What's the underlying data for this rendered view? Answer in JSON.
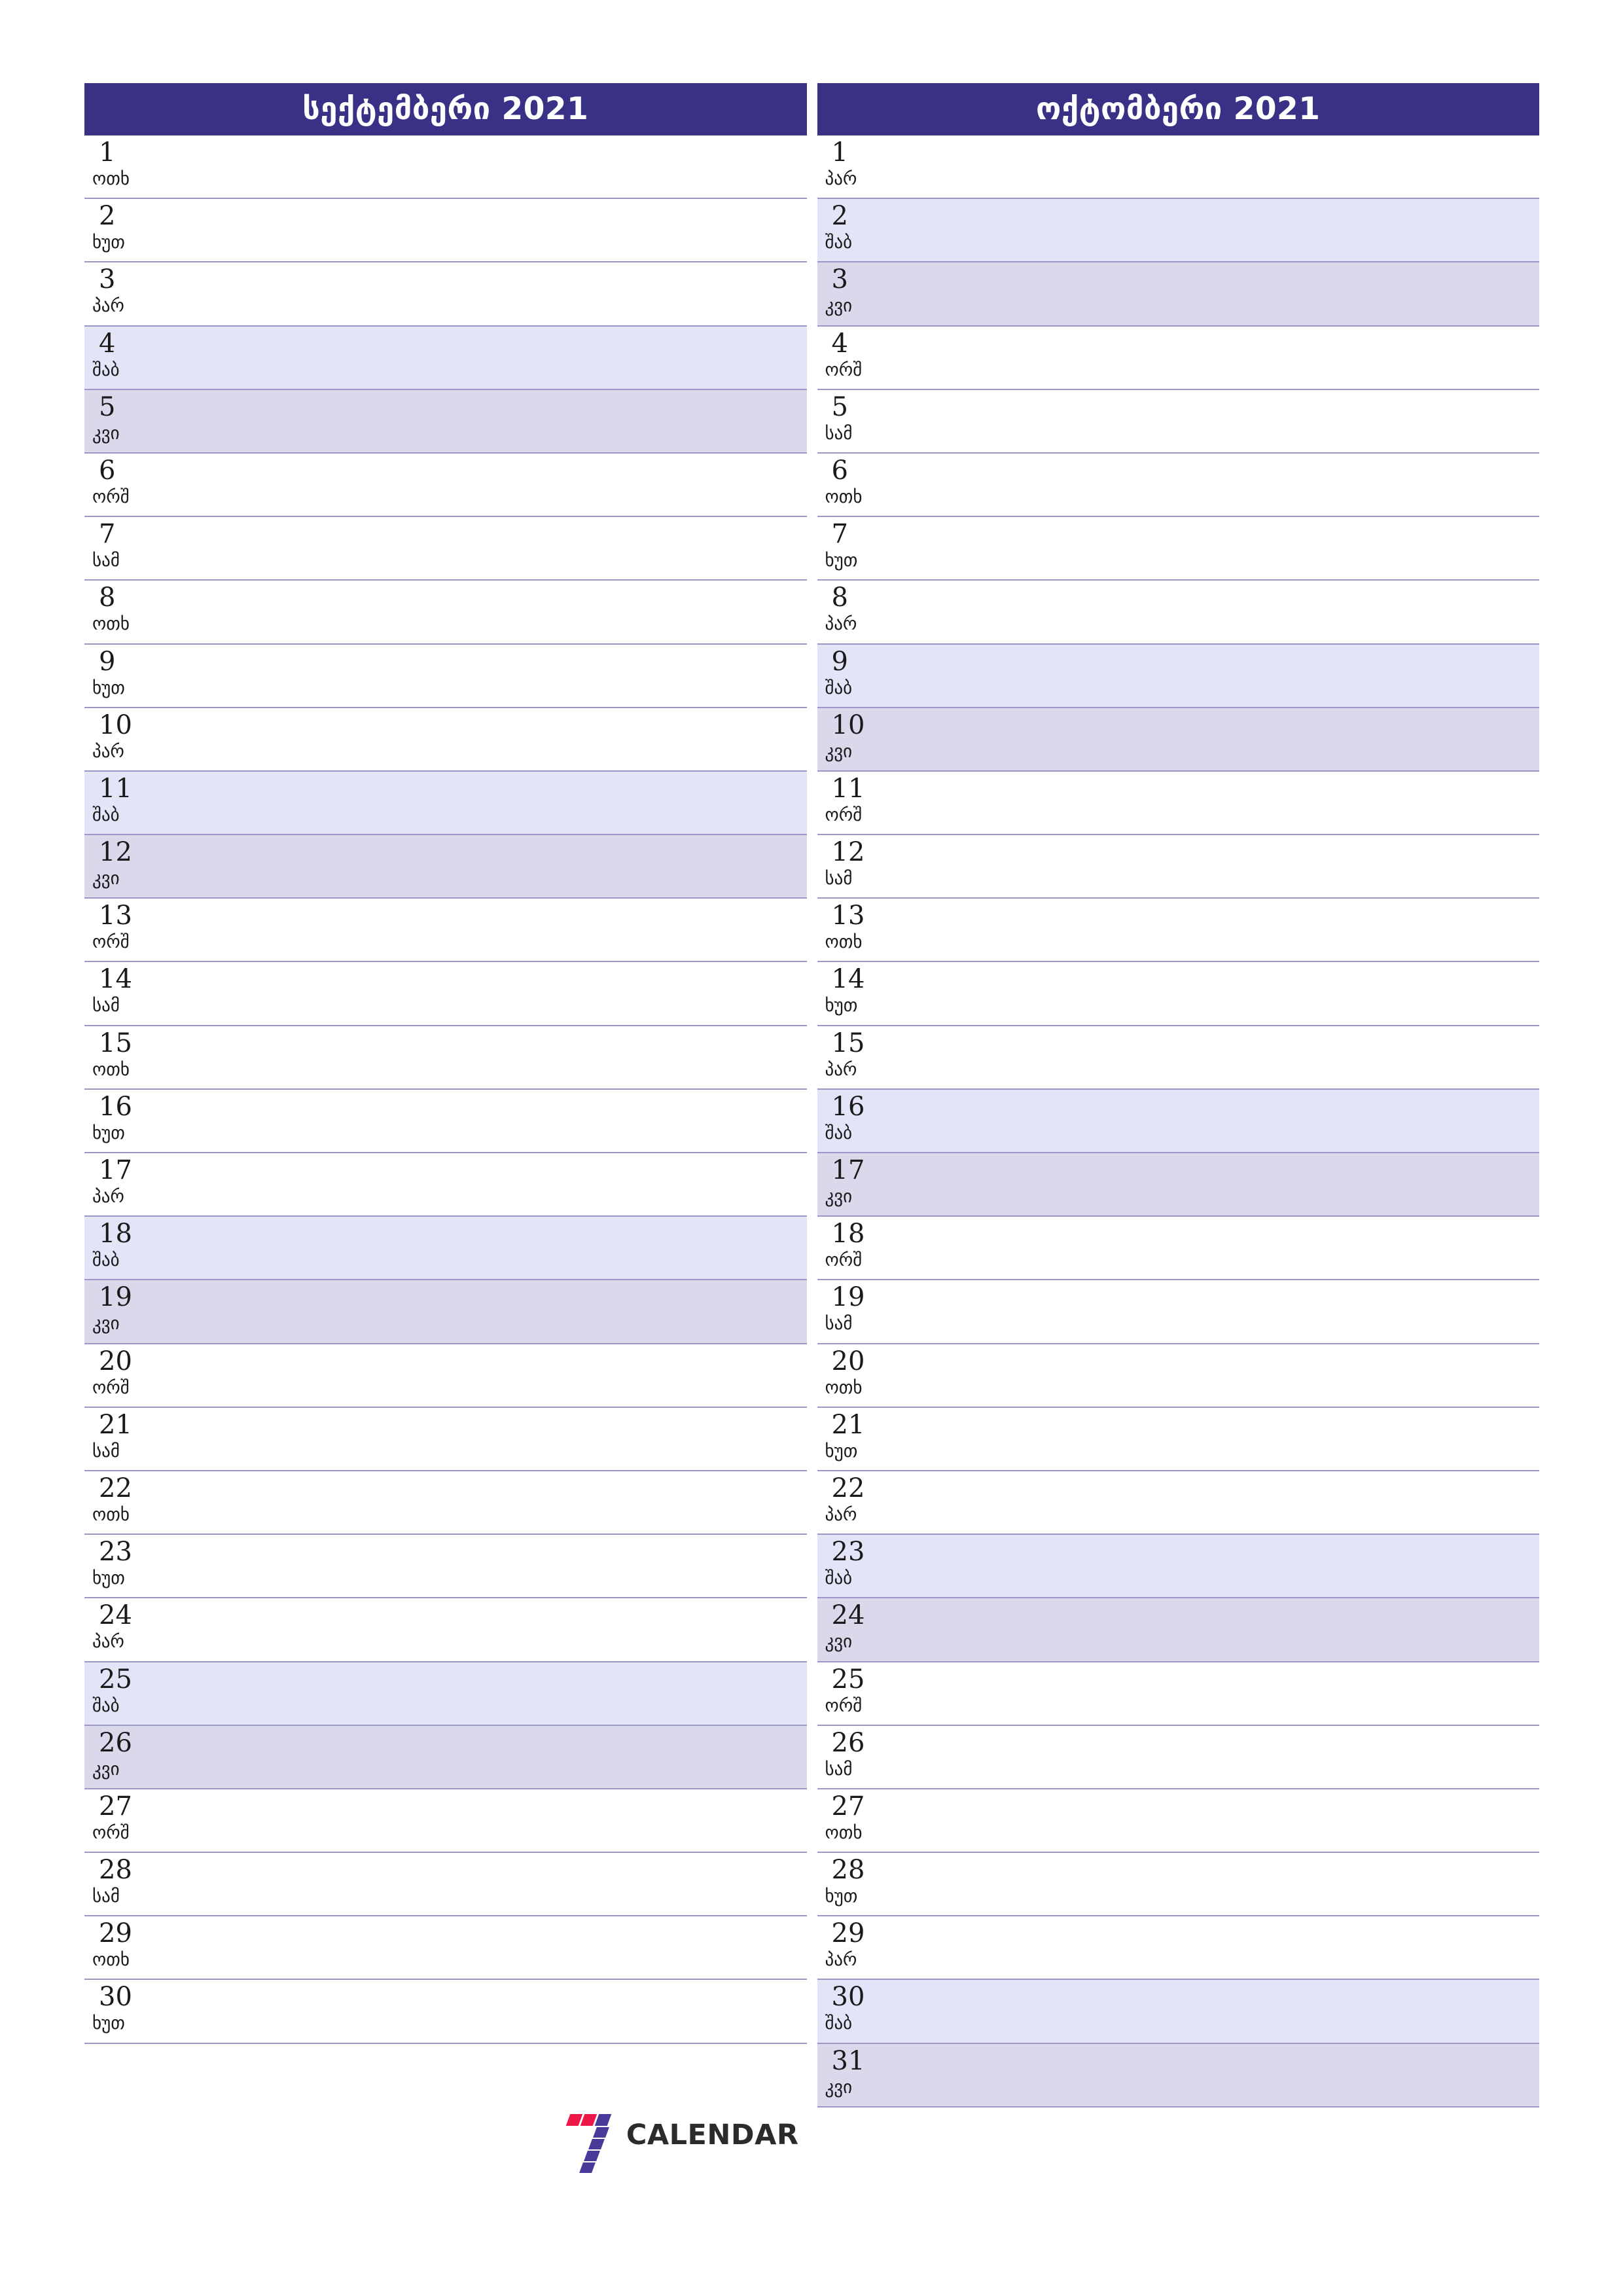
{
  "page": {
    "title": "Monthly planner September October 2021",
    "locale": "ka",
    "colors": {
      "header_bg": "#393185",
      "header_text": "#ffffff",
      "row_border": "#9b98c8",
      "saturday_bg": "#e3e4f7",
      "sunday_bg": "#dcd8ec",
      "day_text": "#1a1a1a",
      "logo_red": "#ed1847",
      "logo_purple": "#473a98",
      "logo_text": "#2b2b2e"
    }
  },
  "logo": {
    "mark": "seven-stripes-icon",
    "text": "CALENDAR"
  },
  "months": [
    {
      "title": "სექტემბერი 2021",
      "name": "სექტემბერი",
      "year": "2021",
      "days": [
        {
          "num": "1",
          "abbr": "ოთხ",
          "type": "weekday"
        },
        {
          "num": "2",
          "abbr": "ხუთ",
          "type": "weekday"
        },
        {
          "num": "3",
          "abbr": "პარ",
          "type": "weekday"
        },
        {
          "num": "4",
          "abbr": "შაბ",
          "type": "sat"
        },
        {
          "num": "5",
          "abbr": "კვი",
          "type": "sun"
        },
        {
          "num": "6",
          "abbr": "ორშ",
          "type": "weekday"
        },
        {
          "num": "7",
          "abbr": "სამ",
          "type": "weekday"
        },
        {
          "num": "8",
          "abbr": "ოთხ",
          "type": "weekday"
        },
        {
          "num": "9",
          "abbr": "ხუთ",
          "type": "weekday"
        },
        {
          "num": "10",
          "abbr": "პარ",
          "type": "weekday"
        },
        {
          "num": "11",
          "abbr": "შაბ",
          "type": "sat"
        },
        {
          "num": "12",
          "abbr": "კვი",
          "type": "sun"
        },
        {
          "num": "13",
          "abbr": "ორშ",
          "type": "weekday"
        },
        {
          "num": "14",
          "abbr": "სამ",
          "type": "weekday"
        },
        {
          "num": "15",
          "abbr": "ოთხ",
          "type": "weekday"
        },
        {
          "num": "16",
          "abbr": "ხუთ",
          "type": "weekday"
        },
        {
          "num": "17",
          "abbr": "პარ",
          "type": "weekday"
        },
        {
          "num": "18",
          "abbr": "შაბ",
          "type": "sat"
        },
        {
          "num": "19",
          "abbr": "კვი",
          "type": "sun"
        },
        {
          "num": "20",
          "abbr": "ორშ",
          "type": "weekday"
        },
        {
          "num": "21",
          "abbr": "სამ",
          "type": "weekday"
        },
        {
          "num": "22",
          "abbr": "ოთხ",
          "type": "weekday"
        },
        {
          "num": "23",
          "abbr": "ხუთ",
          "type": "weekday"
        },
        {
          "num": "24",
          "abbr": "პარ",
          "type": "weekday"
        },
        {
          "num": "25",
          "abbr": "შაბ",
          "type": "sat"
        },
        {
          "num": "26",
          "abbr": "კვი",
          "type": "sun"
        },
        {
          "num": "27",
          "abbr": "ორშ",
          "type": "weekday"
        },
        {
          "num": "28",
          "abbr": "სამ",
          "type": "weekday"
        },
        {
          "num": "29",
          "abbr": "ოთხ",
          "type": "weekday"
        },
        {
          "num": "30",
          "abbr": "ხუთ",
          "type": "weekday"
        }
      ]
    },
    {
      "title": "ოქტომბერი 2021",
      "name": "ოქტომბერი",
      "year": "2021",
      "days": [
        {
          "num": "1",
          "abbr": "პარ",
          "type": "weekday"
        },
        {
          "num": "2",
          "abbr": "შაბ",
          "type": "sat"
        },
        {
          "num": "3",
          "abbr": "კვი",
          "type": "sun"
        },
        {
          "num": "4",
          "abbr": "ორშ",
          "type": "weekday"
        },
        {
          "num": "5",
          "abbr": "სამ",
          "type": "weekday"
        },
        {
          "num": "6",
          "abbr": "ოთხ",
          "type": "weekday"
        },
        {
          "num": "7",
          "abbr": "ხუთ",
          "type": "weekday"
        },
        {
          "num": "8",
          "abbr": "პარ",
          "type": "weekday"
        },
        {
          "num": "9",
          "abbr": "შაბ",
          "type": "sat"
        },
        {
          "num": "10",
          "abbr": "კვი",
          "type": "sun"
        },
        {
          "num": "11",
          "abbr": "ორშ",
          "type": "weekday"
        },
        {
          "num": "12",
          "abbr": "სამ",
          "type": "weekday"
        },
        {
          "num": "13",
          "abbr": "ოთხ",
          "type": "weekday"
        },
        {
          "num": "14",
          "abbr": "ხუთ",
          "type": "weekday"
        },
        {
          "num": "15",
          "abbr": "პარ",
          "type": "weekday"
        },
        {
          "num": "16",
          "abbr": "შაბ",
          "type": "sat"
        },
        {
          "num": "17",
          "abbr": "კვი",
          "type": "sun"
        },
        {
          "num": "18",
          "abbr": "ორშ",
          "type": "weekday"
        },
        {
          "num": "19",
          "abbr": "სამ",
          "type": "weekday"
        },
        {
          "num": "20",
          "abbr": "ოთხ",
          "type": "weekday"
        },
        {
          "num": "21",
          "abbr": "ხუთ",
          "type": "weekday"
        },
        {
          "num": "22",
          "abbr": "პარ",
          "type": "weekday"
        },
        {
          "num": "23",
          "abbr": "შაბ",
          "type": "sat"
        },
        {
          "num": "24",
          "abbr": "კვი",
          "type": "sun"
        },
        {
          "num": "25",
          "abbr": "ორშ",
          "type": "weekday"
        },
        {
          "num": "26",
          "abbr": "სამ",
          "type": "weekday"
        },
        {
          "num": "27",
          "abbr": "ოთხ",
          "type": "weekday"
        },
        {
          "num": "28",
          "abbr": "ხუთ",
          "type": "weekday"
        },
        {
          "num": "29",
          "abbr": "პარ",
          "type": "weekday"
        },
        {
          "num": "30",
          "abbr": "შაბ",
          "type": "sat"
        },
        {
          "num": "31",
          "abbr": "კვი",
          "type": "sun"
        }
      ]
    }
  ]
}
